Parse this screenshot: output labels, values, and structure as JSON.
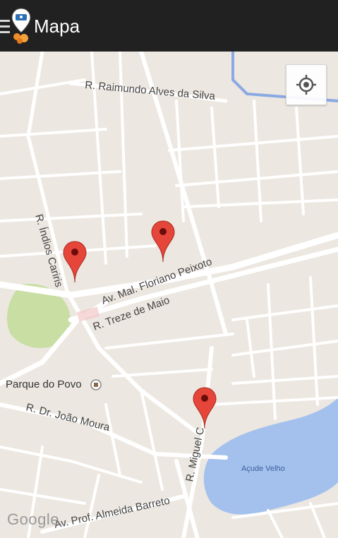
{
  "header": {
    "title": "Mapa"
  },
  "map": {
    "streets": {
      "raimundo": "R. Raimundo Alves da Silva",
      "indios": "R. Índios Cariris",
      "floriano": "Av. Mal. Floriano Peixoto",
      "treze": "R. Treze de Maio",
      "joao": "R. Dr. João Moura",
      "miguel": "R. Miguel C",
      "almeida": "Av. Prof. Almeida Barreto"
    },
    "places": {
      "parque": "Parque do Povo",
      "acude": "Açude Velho"
    },
    "attribution": "Google",
    "marker_count": 3
  },
  "colors": {
    "appbar": "#212121",
    "map_bg": "#ece7e0",
    "road": "#ffffff",
    "park": "#c8dea3",
    "water": "#a4c1ee",
    "marker": "#e6463a"
  }
}
